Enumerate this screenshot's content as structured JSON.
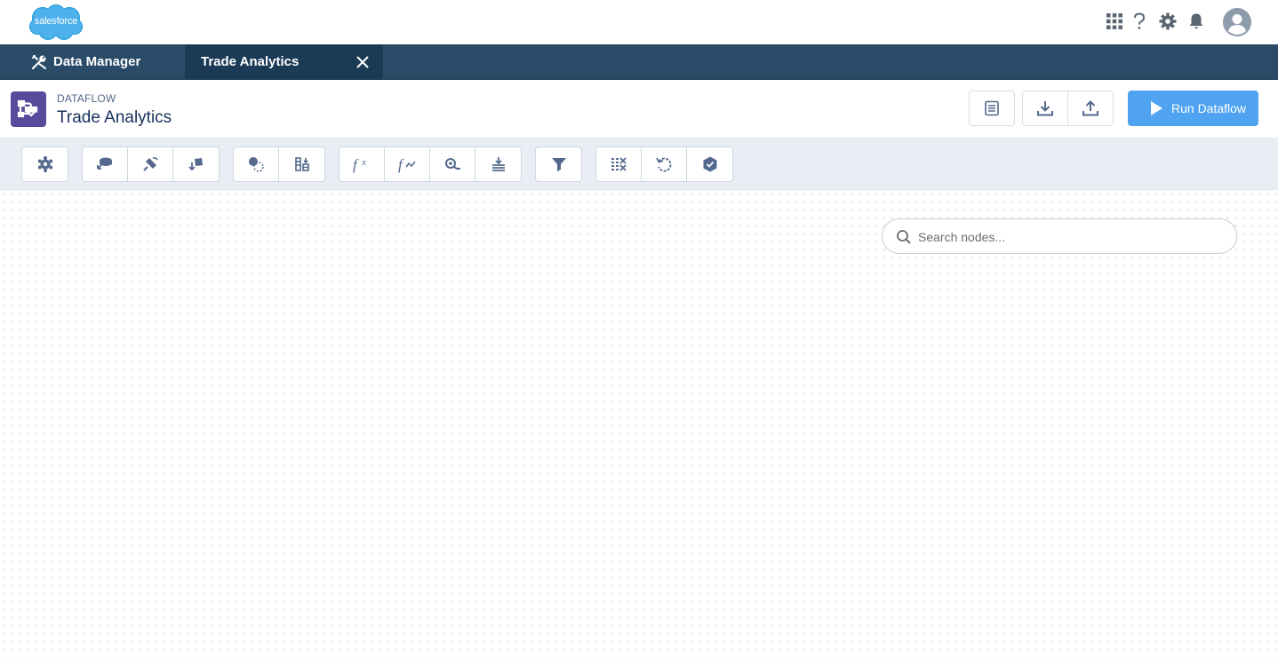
{
  "global_header": {
    "logo_text": "salesforce",
    "icons": [
      "app-launcher-icon",
      "help-icon",
      "setup-gear-icon",
      "notifications-bell-icon",
      "user-avatar-icon"
    ]
  },
  "tabs": {
    "app_label": "Data Manager",
    "active_tab_label": "Trade Analytics"
  },
  "page_header": {
    "eyebrow": "DATAFLOW",
    "title": "Trade Analytics",
    "run_button_label": "Run Dataflow"
  },
  "toolbar": {
    "groups": [
      [
        "sfdc-digest-icon"
      ],
      [
        "digest-icon",
        "edgemart-icon",
        "append-icon"
      ],
      [
        "augment-icon",
        "flatten-icon"
      ],
      [
        "compute-expression-icon",
        "compute-relative-icon",
        "dim2mea-icon",
        "sfdc-register-icon"
      ],
      [
        "filter-icon"
      ],
      [
        "slice-dataset-icon",
        "update-icon",
        "prediction-icon"
      ]
    ]
  },
  "canvas": {
    "search_placeholder": "Search nodes..."
  },
  "colors": {
    "tabbar": "#2a4b68",
    "active_tab": "#1b3a56",
    "run_button": "#4fa3f0",
    "object_icon": "#5a4a9c"
  }
}
